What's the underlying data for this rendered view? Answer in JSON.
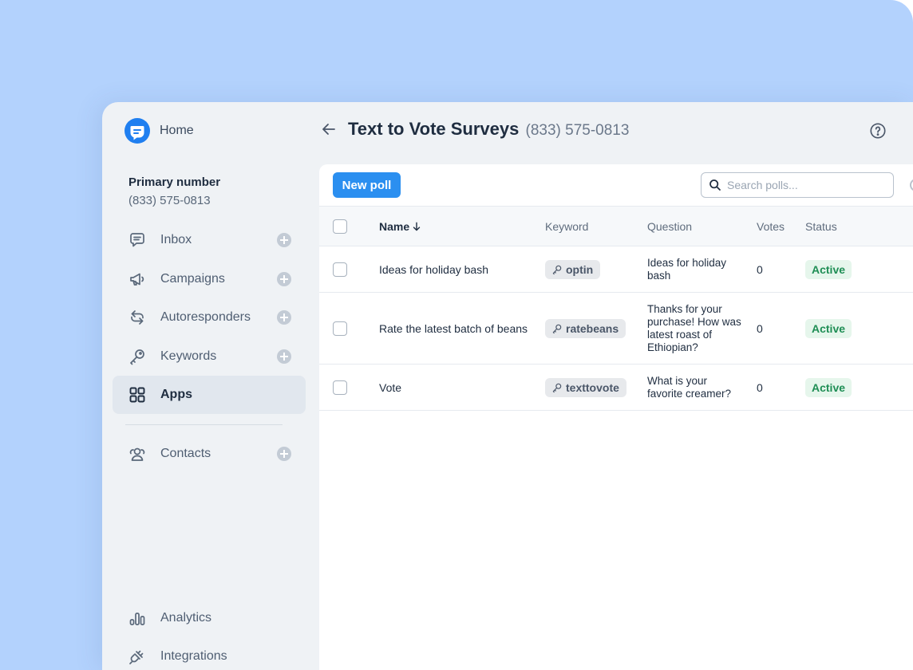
{
  "sidebar": {
    "home_label": "Home",
    "primary_number_title": "Primary number",
    "primary_number": "(833) 575-0813",
    "items": [
      {
        "key": "inbox",
        "label": "Inbox",
        "icon": "chat-bubble-icon",
        "has_add": true
      },
      {
        "key": "campaigns",
        "label": "Campaigns",
        "icon": "megaphone-icon",
        "has_add": true
      },
      {
        "key": "autoresponders",
        "label": "Autoresponders",
        "icon": "reply-arrows-icon",
        "has_add": true
      },
      {
        "key": "keywords",
        "label": "Keywords",
        "icon": "key-icon",
        "has_add": true
      },
      {
        "key": "apps",
        "label": "Apps",
        "icon": "grid-icon",
        "active": true
      },
      {
        "key": "contacts",
        "label": "Contacts",
        "icon": "contacts-icon",
        "has_add": true
      },
      {
        "key": "analytics",
        "label": "Analytics",
        "icon": "bar-chart-icon"
      },
      {
        "key": "integrations",
        "label": "Integrations",
        "icon": "plug-icon"
      }
    ]
  },
  "header": {
    "title": "Text to Vote Surveys",
    "phone": "(833) 575-0813"
  },
  "toolbar": {
    "new_poll_label": "New poll",
    "search_placeholder": "Search polls..."
  },
  "table": {
    "columns": {
      "name": "Name",
      "keyword": "Keyword",
      "question": "Question",
      "votes": "Votes",
      "status": "Status"
    },
    "rows": [
      {
        "name": "Ideas for holiday bash",
        "keyword": "optin",
        "question": "Ideas for holiday bash",
        "votes": "0",
        "status": "Active"
      },
      {
        "name": "Rate the latest batch of beans",
        "keyword": "ratebeans",
        "question": "Thanks for your purchase! How was latest roast of Ethiopian?",
        "votes": "0",
        "status": "Active"
      },
      {
        "name": "Vote",
        "keyword": "texttovote",
        "question": "What is your favorite creamer?",
        "votes": "0",
        "status": "Active"
      }
    ]
  },
  "colors": {
    "backdrop": "#b3d2fd",
    "accent": "#2b8ff0",
    "status_active_text": "#1f8e55",
    "status_active_bg": "#e6f6ec"
  }
}
